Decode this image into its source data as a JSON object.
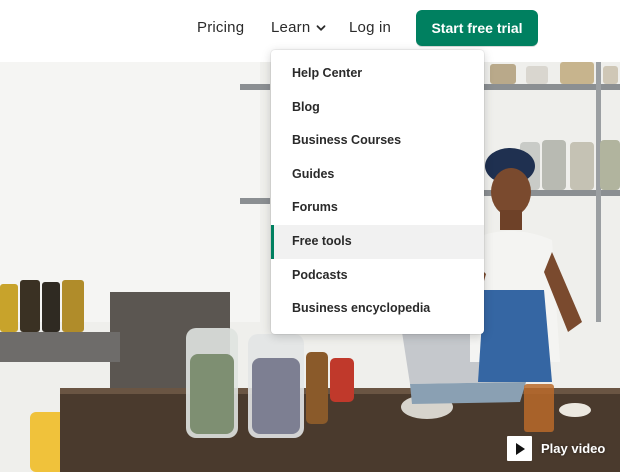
{
  "nav": {
    "pricing": "Pricing",
    "learn": "Learn",
    "login": "Log in",
    "cta": "Start free trial"
  },
  "dropdown": {
    "items": [
      "Help Center",
      "Blog",
      "Business Courses",
      "Guides",
      "Forums",
      "Free tools",
      "Podcasts",
      "Business encyclopedia"
    ],
    "active_item": "Free tools"
  },
  "video": {
    "label": "Play video",
    "icon": "play-icon"
  },
  "colors": {
    "brand_green": "#008060",
    "active_bg": "#f1f1f1",
    "text": "#2a2a2a"
  },
  "icons": {
    "learn_caret": "chevron-down-icon"
  }
}
